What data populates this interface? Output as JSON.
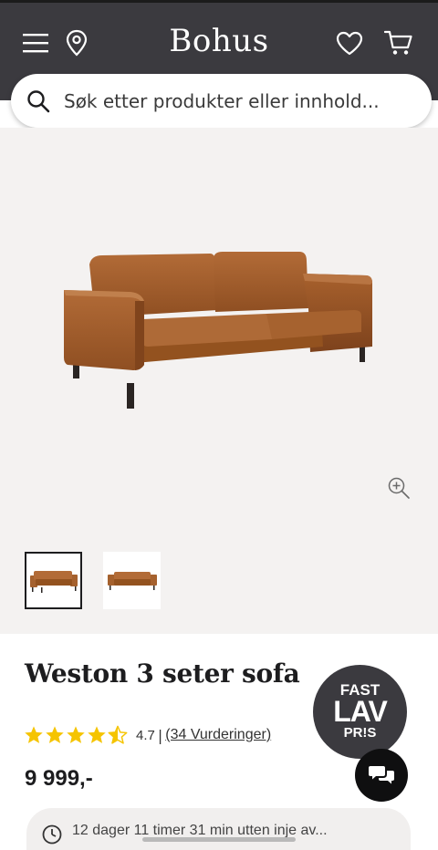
{
  "header": {
    "logo": "Bohus",
    "icons": [
      "menu-icon",
      "location-pin-icon",
      "heart-icon",
      "cart-icon"
    ],
    "background": "#3b3a3f"
  },
  "search": {
    "placeholder": "Søk etter produkter eller innhold..."
  },
  "gallery": {
    "thumbnails": [
      {
        "label": "sofa-front-view",
        "selected": true
      },
      {
        "label": "sofa-side-view",
        "selected": false
      }
    ]
  },
  "product": {
    "title": "Weston 3 seter sofa",
    "rating": 4.7,
    "rating_text": "4.7",
    "separator": "|",
    "reviews_text": "(34 Vurderinger)",
    "price": "9 999,-",
    "star_color": "#f5c400"
  },
  "badge": {
    "line1": "FAST",
    "line2": "LAV",
    "line3": "PR!S"
  },
  "delivery": {
    "text": "12 dager 11 timer 31 min utten inje av..."
  },
  "colors": {
    "hero_bg": "#f4f2f1",
    "sofa": "#a5612e"
  }
}
